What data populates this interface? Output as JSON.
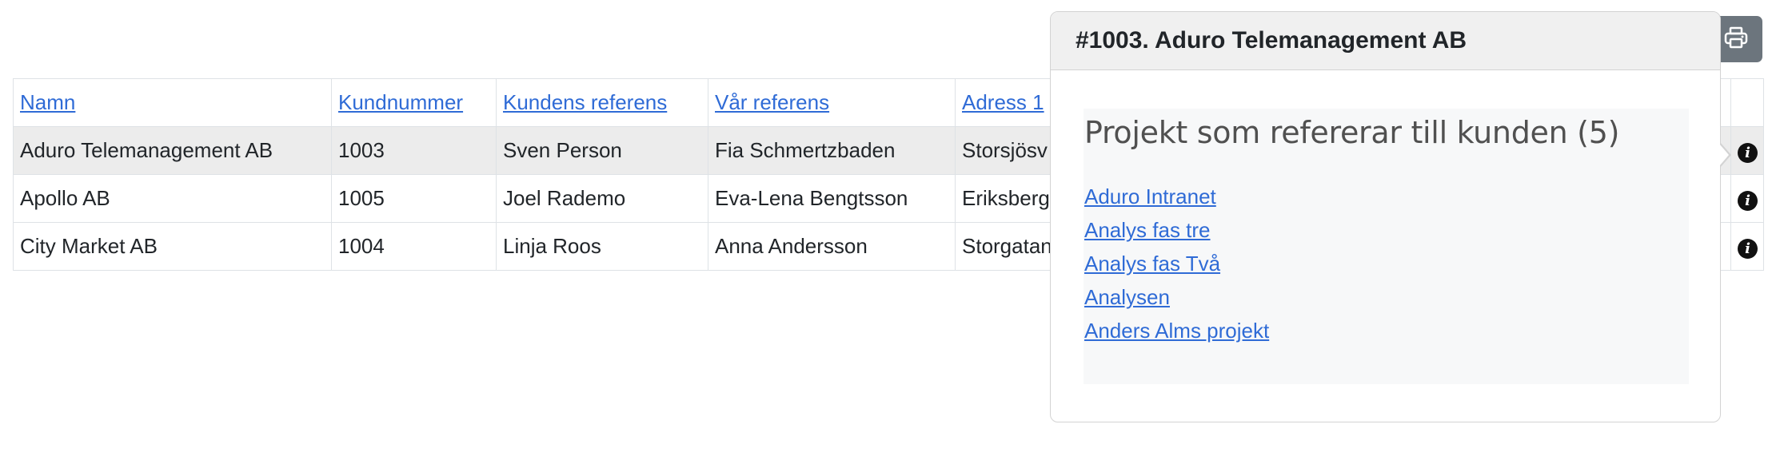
{
  "table": {
    "headers": [
      "Namn",
      "Kundnummer",
      "Kundens referens",
      "Vår referens",
      "Adress 1"
    ],
    "rows": [
      {
        "name": "Aduro Telemanagement AB",
        "number": "1003",
        "customer_ref": "Sven Person",
        "our_ref": "Fia Schmertzbaden",
        "address": "Storsjösv"
      },
      {
        "name": "Apollo AB",
        "number": "1005",
        "customer_ref": "Joel Rademo",
        "our_ref": "Eva-Lena Bengtsson",
        "address": "Eriksberg"
      },
      {
        "name": "City Market AB",
        "number": "1004",
        "customer_ref": "Linja Roos",
        "our_ref": "Anna Andersson",
        "address": "Storgatan"
      }
    ],
    "info_icon": "i"
  },
  "toolbar": {
    "print_icon": "printer-icon"
  },
  "popover": {
    "title": "#1003. Aduro Telemanagement AB",
    "section_title": "Projekt som refererar till kunden (5)",
    "projects": [
      "Aduro Intranet",
      "Analys fas tre",
      "Analys fas Två",
      "Analysen",
      "Anders Alms projekt"
    ]
  },
  "colors": {
    "link": "#2f6bd6",
    "highlight_row": "#ececec",
    "print_button": "#6c757d"
  }
}
